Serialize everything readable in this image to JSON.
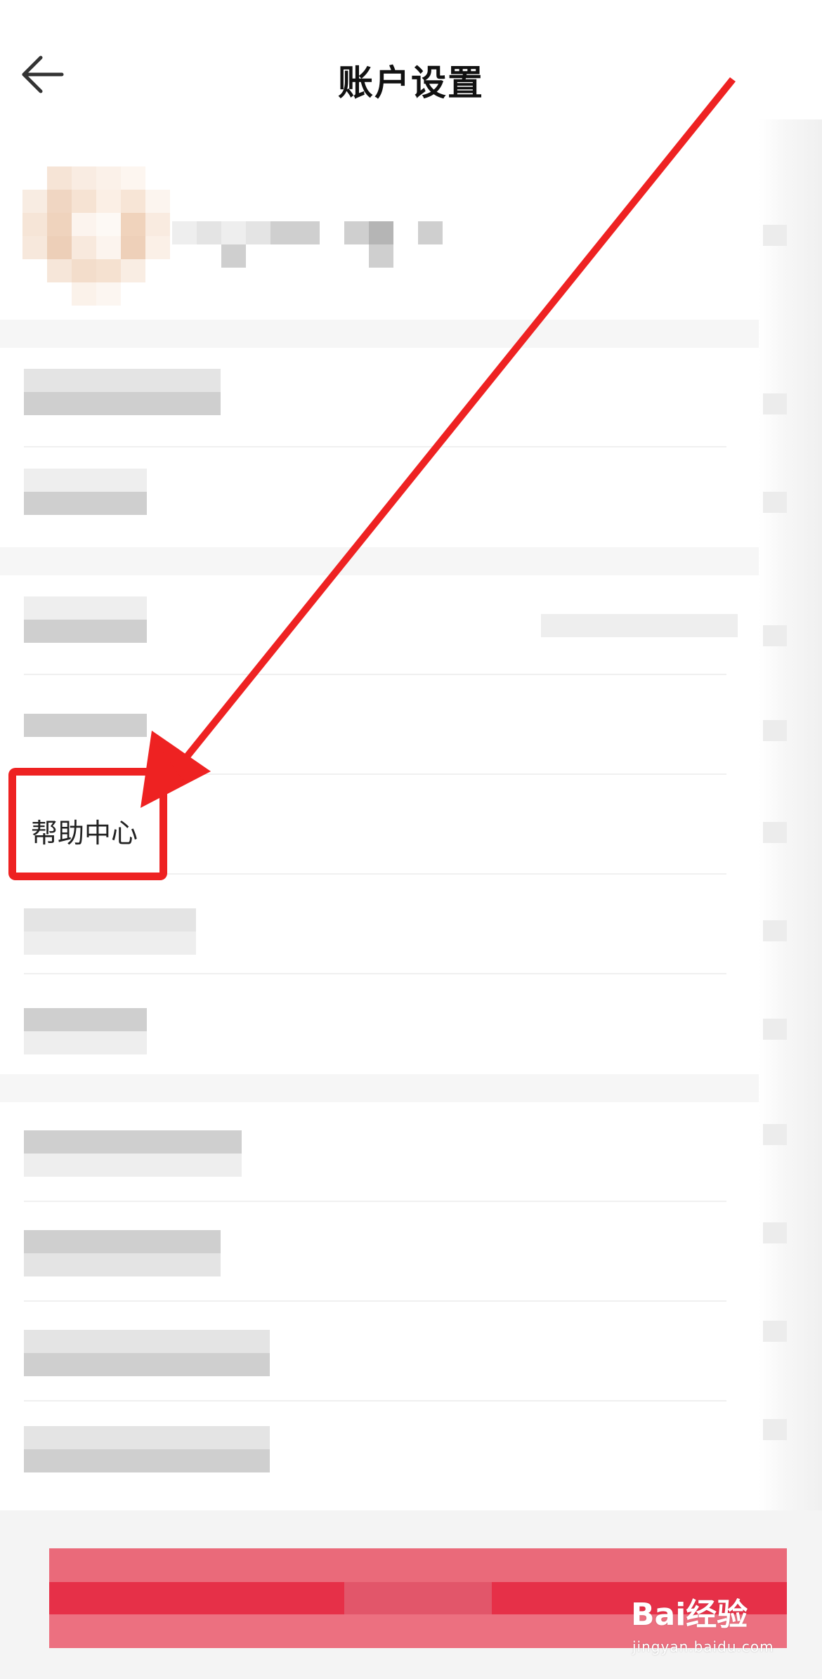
{
  "header": {
    "title": "账户设置",
    "back_icon": "arrow-left-icon"
  },
  "rows": {
    "help_center_label": "帮助中心"
  },
  "colors": {
    "annotation": "#ee2222",
    "logout_button": "#e63048"
  },
  "watermark": {
    "brand": "Bai经验",
    "url": "jingyan.baidu.com"
  }
}
